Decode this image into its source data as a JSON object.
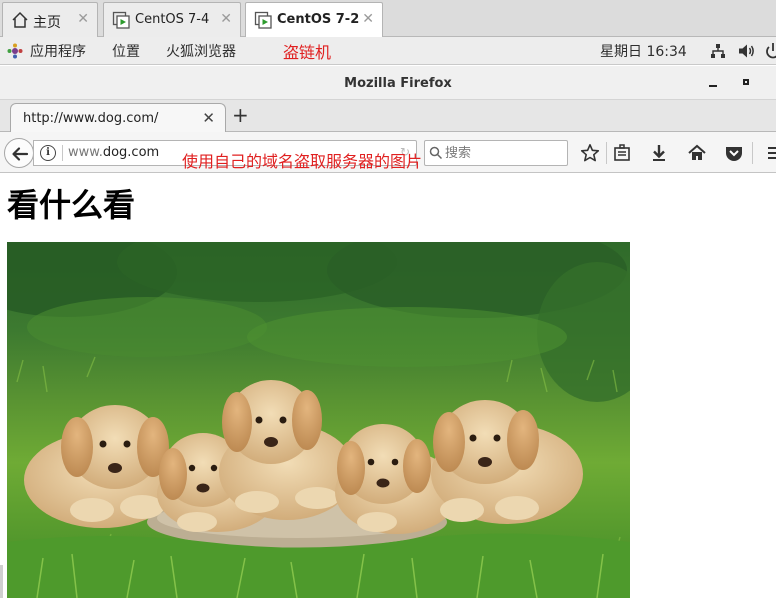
{
  "vm_tabs": [
    {
      "label": "主页",
      "icon": "home-icon"
    },
    {
      "label": "CentOS 7-4",
      "icon": "vm-icon"
    },
    {
      "label": "CentOS 7-2",
      "icon": "vm-icon",
      "active": true
    }
  ],
  "topbar": {
    "applications": "应用程序",
    "places": "位置",
    "firefox": "火狐浏览器",
    "annotation": "盗链机",
    "clock": "星期日 16:34"
  },
  "window": {
    "title": "Mozilla Firefox"
  },
  "browser": {
    "tab_label": "http://www.dog.com/",
    "url_prefix": "www.",
    "url_domain": "dog.com",
    "search_placeholder": "搜索",
    "annotation": "使用自己的域名盗取服务器的图片"
  },
  "page": {
    "heading": "看什么看"
  },
  "colors": {
    "annotation": "#e02020",
    "vm_icon": "#2d9b2d"
  }
}
